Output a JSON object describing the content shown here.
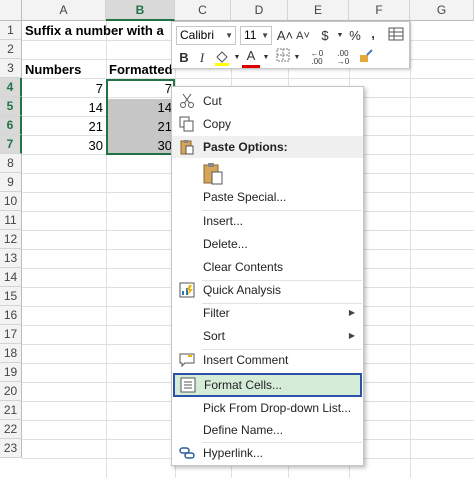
{
  "columns": [
    "A",
    "B",
    "C",
    "D",
    "E",
    "F",
    "G"
  ],
  "rows": [
    "1",
    "2",
    "3",
    "4",
    "5",
    "6",
    "7",
    "8",
    "9",
    "10",
    "11",
    "12",
    "13",
    "14",
    "15",
    "16",
    "17",
    "18",
    "19",
    "20",
    "21",
    "22",
    "23"
  ],
  "cells": {
    "a1": "Suffix a number with a",
    "a3": "Numbers",
    "b3": "Formatted",
    "a4": "7",
    "b4": "7",
    "a5": "14",
    "b5": "14",
    "a6": "21",
    "b6": "21",
    "a7": "30",
    "b7": "30"
  },
  "mini_toolbar": {
    "font": "Calibri",
    "size": "11",
    "grow": "A˄",
    "shrink": "A˅",
    "currency": "$",
    "percent": "%",
    "comma": ",",
    "bold": "B",
    "italic": "I",
    "font_color": "A"
  },
  "menu": {
    "cut": "Cut",
    "copy": "Copy",
    "paste_options": "Paste Options:",
    "paste_special": "Paste Special...",
    "insert": "Insert...",
    "delete": "Delete...",
    "clear_contents": "Clear Contents",
    "quick_analysis": "Quick Analysis",
    "filter": "Filter",
    "sort": "Sort",
    "insert_comment": "Insert Comment",
    "format_cells": "Format Cells...",
    "pick_list": "Pick From Drop-down List...",
    "define_name": "Define Name...",
    "hyperlink": "Hyperlink..."
  },
  "colors": {
    "accent": "#217346",
    "highlight_fill": "#d5ecd9",
    "highlight_border": "#2b52a8"
  }
}
